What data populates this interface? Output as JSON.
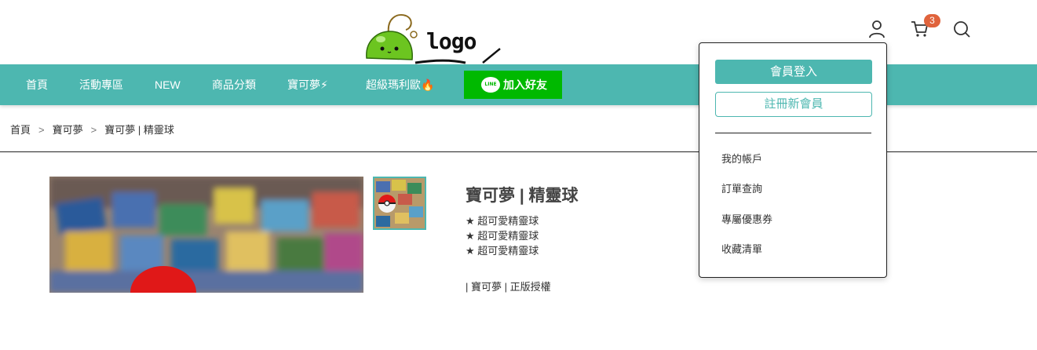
{
  "header": {
    "logo_text": "logo",
    "cart_count": "3"
  },
  "nav": {
    "items": [
      "首頁",
      "活動專區",
      "NEW",
      "商品分類",
      "寶可夢⚡",
      "超級瑪利歐🔥"
    ],
    "line_button": {
      "icon_text": "LINE",
      "label": "加入好友"
    }
  },
  "breadcrumb": {
    "items": [
      "首頁",
      "寶可夢",
      "寶可夢 | 精靈球"
    ],
    "separator": ">"
  },
  "product": {
    "title": "寶可夢 | 精靈球",
    "features": [
      "★ 超可愛精靈球",
      "★ 超可愛精靈球",
      "★ 超可愛精靈球"
    ],
    "tags": "| 寶可夢 | 正版授權"
  },
  "account_menu": {
    "login_label": "會員登入",
    "register_label": "註冊新會員",
    "links": [
      "我的帳戶",
      "訂單查詢",
      "專屬優惠券",
      "收藏清單"
    ]
  },
  "colors": {
    "accent": "#4db7b0",
    "line_green": "#00b900",
    "badge": "#e0633c"
  }
}
